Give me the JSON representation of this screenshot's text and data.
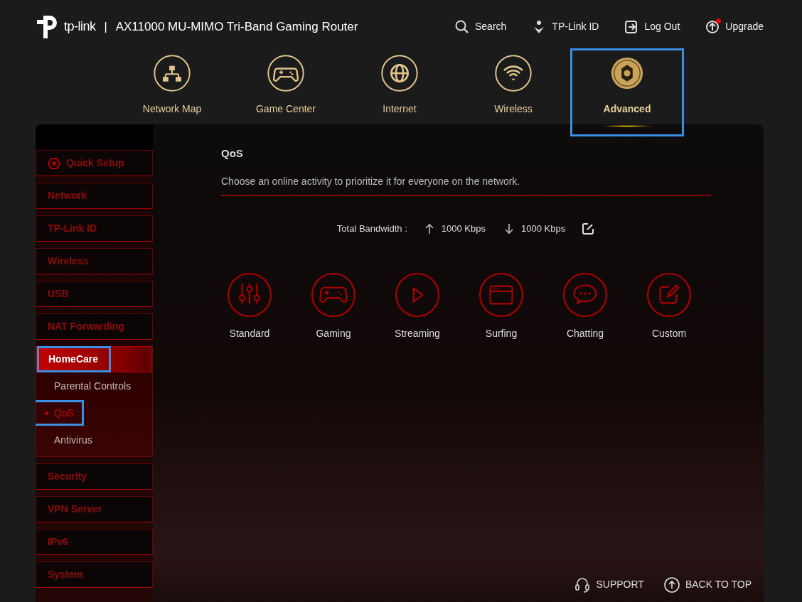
{
  "header": {
    "logo_text": "tp-link",
    "separator": "|",
    "title": "AX11000 MU-MIMO Tri-Band Gaming Router",
    "links": [
      {
        "label": "Search",
        "kind": "search",
        "alert": false
      },
      {
        "label": "TP-Link ID",
        "kind": "account",
        "alert": false
      },
      {
        "label": "Log Out",
        "kind": "logout",
        "alert": false
      },
      {
        "label": "Upgrade",
        "kind": "upgrade",
        "alert": true
      }
    ]
  },
  "nav": [
    {
      "label": "Network Map",
      "kind": "map",
      "selected": false,
      "highlighted": false
    },
    {
      "label": "Game Center",
      "kind": "game",
      "selected": false,
      "highlighted": false
    },
    {
      "label": "Internet",
      "kind": "globe",
      "selected": false,
      "highlighted": false
    },
    {
      "label": "Wireless",
      "kind": "wifi",
      "selected": false,
      "highlighted": false
    },
    {
      "label": "Advanced",
      "kind": "gear",
      "selected": true,
      "highlighted": true
    }
  ],
  "sidebar": {
    "items": [
      {
        "label": "Quick Setup",
        "kind": "setup",
        "selected": false,
        "highlighted": false,
        "expanded": false
      },
      {
        "label": "Network",
        "kind": "menu",
        "selected": false,
        "highlighted": false,
        "expanded": false
      },
      {
        "label": "TP-Link ID",
        "kind": "menu",
        "selected": false,
        "highlighted": false,
        "expanded": false
      },
      {
        "label": "Wireless",
        "kind": "menu",
        "selected": false,
        "highlighted": false,
        "expanded": false
      },
      {
        "label": "USB",
        "kind": "menu",
        "selected": false,
        "highlighted": false,
        "expanded": false
      },
      {
        "label": "NAT Forwarding",
        "kind": "menu",
        "selected": false,
        "highlighted": false,
        "expanded": false
      },
      {
        "label": "HomeCare",
        "kind": "menu",
        "selected": true,
        "highlighted": true,
        "expanded": true,
        "children": [
          {
            "label": "Parental Controls",
            "selected": false,
            "highlighted": false
          },
          {
            "label": "QoS",
            "selected": true,
            "highlighted": true
          },
          {
            "label": "Antivirus",
            "selected": false,
            "highlighted": false
          }
        ]
      },
      {
        "label": "Security",
        "kind": "menu",
        "selected": false,
        "highlighted": false,
        "expanded": false
      },
      {
        "label": "VPN Server",
        "kind": "menu",
        "selected": false,
        "highlighted": false,
        "expanded": false
      },
      {
        "label": "IPv6",
        "kind": "menu",
        "selected": false,
        "highlighted": false,
        "expanded": false
      },
      {
        "label": "System",
        "kind": "menu",
        "selected": false,
        "highlighted": false,
        "expanded": false
      }
    ]
  },
  "content": {
    "title": "QoS",
    "description": "Choose an online activity to prioritize it for everyone on the network.",
    "bandwidth": {
      "label": "Total Bandwidth :",
      "upload": "1000 Kbps",
      "download": "1000 Kbps"
    },
    "modes": [
      {
        "label": "Standard",
        "kind": "standard"
      },
      {
        "label": "Gaming",
        "kind": "gaming"
      },
      {
        "label": "Streaming",
        "kind": "streaming"
      },
      {
        "label": "Surfing",
        "kind": "surfing"
      },
      {
        "label": "Chatting",
        "kind": "chatting"
      },
      {
        "label": "Custom",
        "kind": "custom"
      }
    ]
  },
  "footer": [
    {
      "label": "SUPPORT",
      "kind": "support"
    },
    {
      "label": "BACK TO TOP",
      "kind": "top"
    }
  ]
}
